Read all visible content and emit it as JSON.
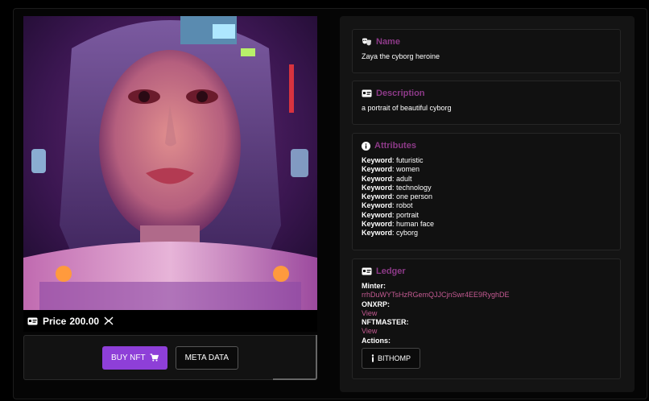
{
  "nft": {
    "price_label": "Price",
    "price_value": "200.00",
    "buy_label": "BUY NFT",
    "meta_label": "META DATA"
  },
  "name_card": {
    "title": "Name",
    "value": "Zaya the cyborg heroine"
  },
  "description_card": {
    "title": "Description",
    "value": "a portrait of beautiful cyborg"
  },
  "attributes_card": {
    "title": "Attributes",
    "items": [
      {
        "key": "Keyword",
        "value": "futuristic"
      },
      {
        "key": "Keyword",
        "value": "women"
      },
      {
        "key": "Keyword",
        "value": "adult"
      },
      {
        "key": "Keyword",
        "value": "technology"
      },
      {
        "key": "Keyword",
        "value": "one person"
      },
      {
        "key": "Keyword",
        "value": "robot"
      },
      {
        "key": "Keyword",
        "value": "portrait"
      },
      {
        "key": "Keyword",
        "value": "human face"
      },
      {
        "key": "Keyword",
        "value": "cyborg"
      }
    ]
  },
  "ledger_card": {
    "title": "Ledger",
    "minter_label": "Minter:",
    "minter_value": "rrhDuWYTsHzRGemQJJCjnSwr4EE9RyghDE",
    "onxrp_label": "ONXRP:",
    "onxrp_link": "View",
    "nftmaster_label": "NFTMASTER:",
    "nftmaster_link": "View",
    "actions_label": "Actions:",
    "bithomp_label": "BITHOMP"
  },
  "colors": {
    "accent": "#8e3fd8",
    "title": "#8d3a88",
    "link": "#c45a92"
  }
}
